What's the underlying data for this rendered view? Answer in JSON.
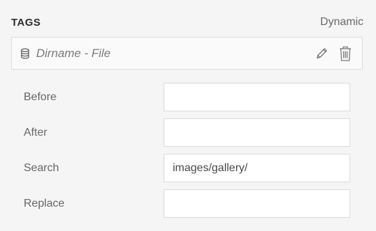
{
  "header": {
    "title": "TAGS",
    "mode": "Dynamic"
  },
  "source": {
    "icon": "database-icon",
    "label": "Dirname - File",
    "edit_icon": "pencil-icon",
    "delete_icon": "trash-icon"
  },
  "fields": [
    {
      "label": "Before",
      "value": ""
    },
    {
      "label": "After",
      "value": ""
    },
    {
      "label": "Search",
      "value": "images/gallery/"
    },
    {
      "label": "Replace",
      "value": ""
    }
  ]
}
